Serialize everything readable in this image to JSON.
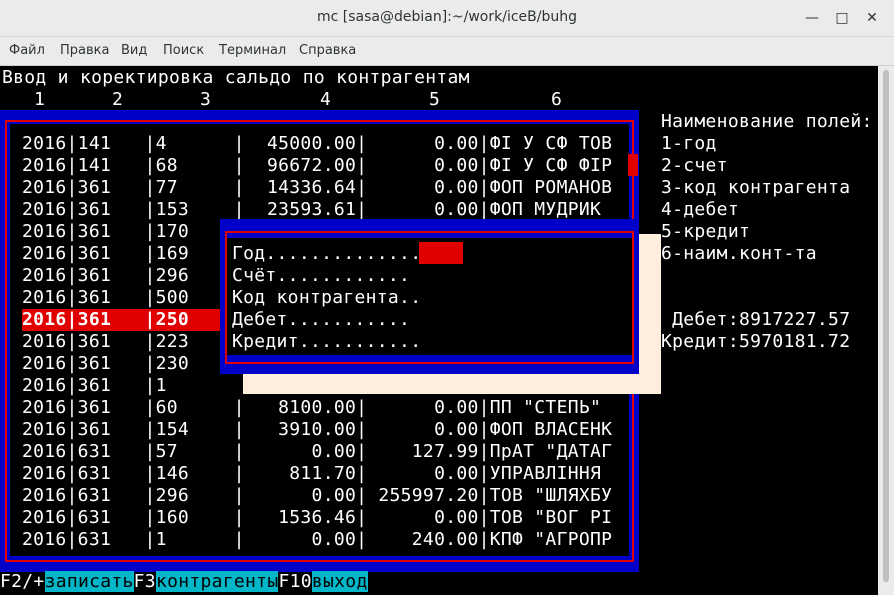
{
  "window": {
    "title": "mc [sasa@debian]:~/work/iceB/buhg",
    "minimize_glyph": "—",
    "maximize_glyph": "□",
    "close_glyph": "✕"
  },
  "menu": [
    "Файл",
    "Правка",
    "Вид",
    "Поиск",
    "Терминал",
    "Справка"
  ],
  "screen": {
    "heading": "Ввод и коректировка сальдо по контрагентам",
    "column_numbers": [
      "1",
      "2",
      "3",
      "4",
      "5",
      "6"
    ],
    "rows": [
      "2016|141   |4      |  45000.00|      0.00|ФІ У СФ ТОВ",
      "2016|141   |68     |  96672.00|      0.00|ФІ У СФ ФІР",
      "2016|361   |77     |  14336.64|      0.00|ФОП РОМАНОВ",
      "2016|361   |153    |  23593.61|      0.00|ФОП МУДРИК",
      "2016|361   |170",
      "2016|361   |169",
      "2016|361   |296",
      "2016|361   |500",
      "2016|361   |250",
      "2016|361   |223",
      "2016|361   |230",
      "2016|361   |1",
      "2016|361   |60     |   8100.00|      0.00|ПП \"СТЕПЬ\"",
      "2016|361   |154    |   3910.00|      0.00|ФОП ВЛАСЕНК",
      "2016|631   |57     |      0.00|    127.99|ПрАТ \"ДАТАГ",
      "2016|631   |146    |    811.70|      0.00|УПРАВЛІННЯ",
      "2016|631   |296    |      0.00| 255997.20|ТОВ \"ШЛЯХБУ",
      "2016|631   |160    |   1536.46|      0.00|ТОВ \"ВОГ РІ",
      "2016|631   |1      |      0.00|    240.00|КПФ \"АГРОПР"
    ],
    "selected_row_index": 8,
    "field_names_title": "Наименование полей:",
    "field_names": [
      "1-год",
      "2-счет",
      "3-код контрагента",
      "4-дебет",
      "5-кредит",
      "6-наим.конт-та"
    ],
    "debet_total": " Дебет:8917227.57",
    "kredit_total": "Кредит:5970181.72"
  },
  "dialog": {
    "fields": [
      "Год..............",
      "Счёт............",
      "Код контрагента..",
      "Дебет...........",
      "Кредит..........."
    ]
  },
  "function_keys": [
    {
      "key": "F2/+",
      "label": "записать"
    },
    {
      "key": "F3",
      "label": "контрагенты"
    },
    {
      "key": "F10",
      "label": "выход"
    }
  ],
  "colors": {
    "frame_blue": "#0000c8",
    "border_red": "#e00000",
    "fkey_label_bg": "#00b6c8",
    "shadow": "#fdeedd"
  }
}
